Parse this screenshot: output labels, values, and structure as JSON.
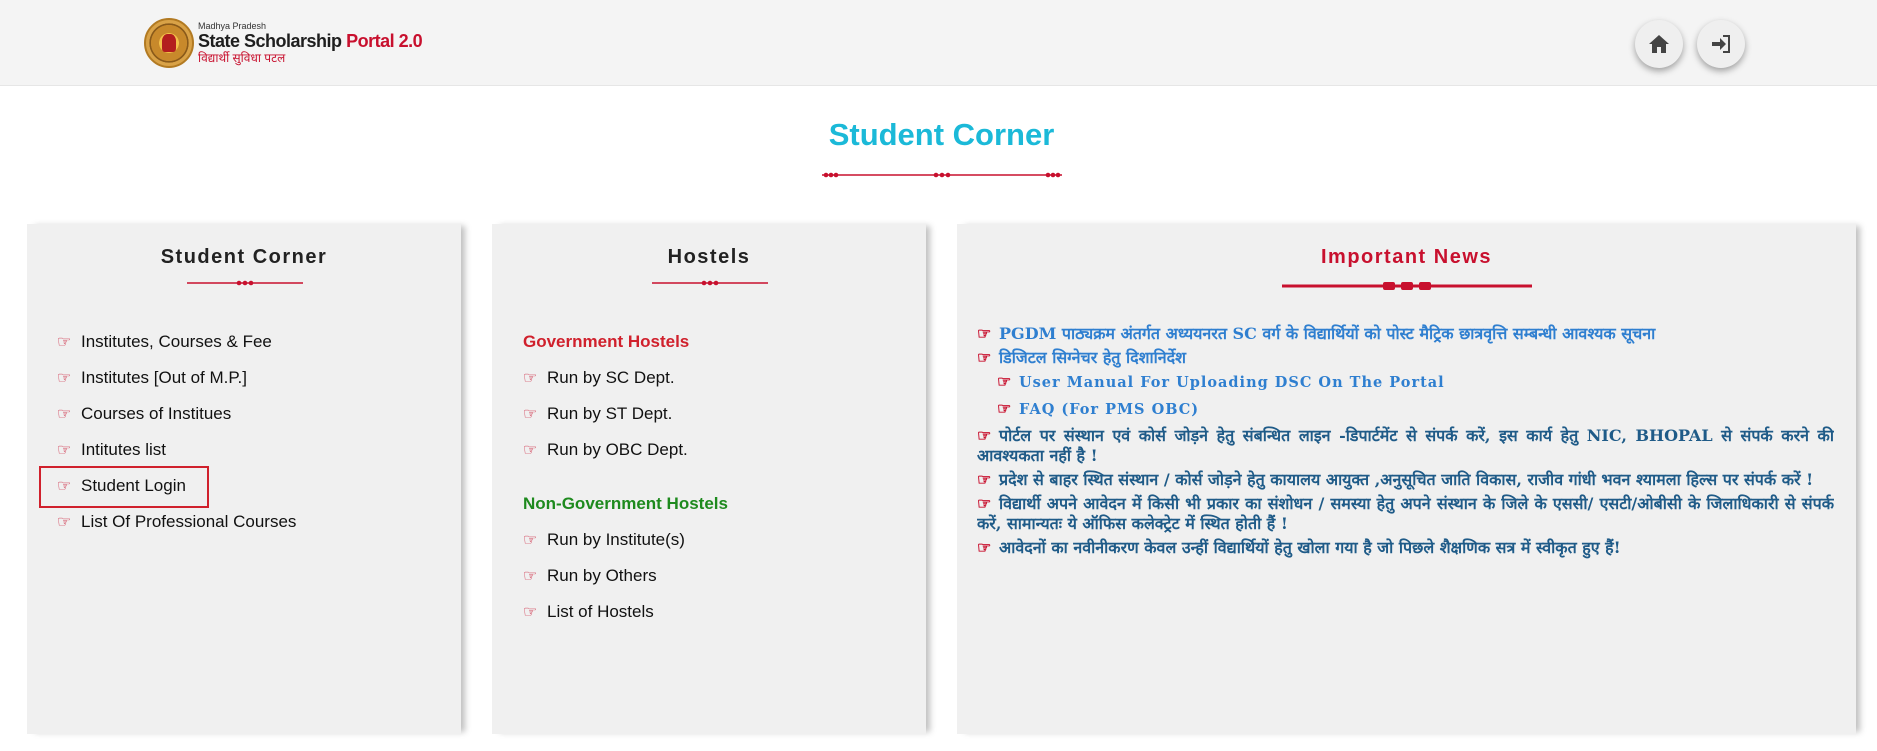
{
  "header": {
    "logo": {
      "state": "Madhya Pradesh",
      "title_main": "State Scholarship",
      "title_accent": "Portal 2.0",
      "tagline": "विद्यार्थी सुविधा पटल"
    },
    "home_icon": "home-icon",
    "login_icon": "sign-in-icon"
  },
  "page": {
    "title": "Student Corner"
  },
  "student_corner": {
    "title": "Student Corner",
    "items": [
      {
        "label": "Institutes, Courses & Fee"
      },
      {
        "label": "Institutes [Out of M.P.]"
      },
      {
        "label": "Courses of Institues"
      },
      {
        "label": "Intitutes list"
      },
      {
        "label": "Student Login"
      },
      {
        "label": "List Of Professional Courses"
      }
    ]
  },
  "hostels": {
    "title": "Hostels",
    "government_heading": "Government Hostels",
    "government_items": [
      {
        "label": "Run by SC Dept."
      },
      {
        "label": "Run by ST Dept."
      },
      {
        "label": "Run by OBC Dept."
      }
    ],
    "nongovernment_heading": "Non-Government Hostels",
    "nongovernment_items": [
      {
        "label": "Run by Institute(s)"
      },
      {
        "label": "Run by Others"
      },
      {
        "label": "List of Hostels"
      }
    ]
  },
  "news": {
    "title": "Important News",
    "items": [
      {
        "text": "PGDM पाठ्यक्रम अंतर्गत अध्ययनरत SC वर्ग के विद्यार्थियों को पोस्ट मैट्रिक छात्रवृत्ति सम्बन्धी आवश्यक सूचना"
      },
      {
        "text": "डिजिटल सिग्नेचर हेतु दिशानिर्देश"
      },
      {
        "text": "User Manual For Uploading DSC On The Portal"
      },
      {
        "text": "FAQ (For PMS OBC)"
      },
      {
        "text": "पोर्टल पर संस्थान एवं कोर्स जोड़ने हेतु संबन्धित लाइन -डिपार्टमेंट से संपर्क करें, इस कार्य हेतु NIC, BHOPAL से संपर्क करने की आवश्यकता नहीं है !"
      },
      {
        "text": "प्रदेश से बाहर स्थित संस्थान / कोर्स जोड़ने हेतु कायालय आयुक्त ,अनुसूचित जाति विकास, राजीव गांधी भवन श्यामला हिल्स पर संपर्क करें !"
      },
      {
        "text": "विद्यार्थी अपने आवेदन में किसी भी प्रकार का संशोधन / समस्या हेतु अपने संस्थान के जिले के एससी/ एसटी/ओबीसी के जिलाधिकारी से संपर्क करें, सामान्यतः ये ऑफिस कलेक्ट्रेट में स्थित होती हैं !"
      },
      {
        "text": "आवेदनों का नवीनीकरण केवल उन्हीं विद्यार्थियों हेतु खोला गया है जो पिछले शैक्षणिक सत्र में स्वीकृत हुए हैं!"
      }
    ]
  },
  "colors": {
    "accent_cyan": "#1bb9d8",
    "accent_red": "#c8102e",
    "news_blue": "#2f7fd0",
    "news_dark": "#1f5b88",
    "green": "#1e8a1e"
  }
}
